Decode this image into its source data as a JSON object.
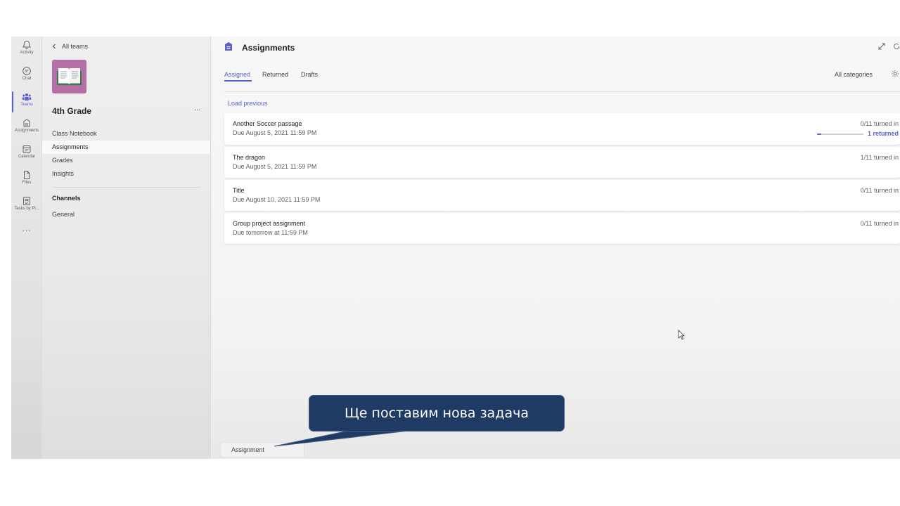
{
  "rail": {
    "items": [
      {
        "label": "Activity",
        "icon": "bell-icon"
      },
      {
        "label": "Chat",
        "icon": "chat-icon"
      },
      {
        "label": "Teams",
        "icon": "teams-icon",
        "active": true
      },
      {
        "label": "Assignments",
        "icon": "assignments-icon"
      },
      {
        "label": "Calendar",
        "icon": "calendar-icon"
      },
      {
        "label": "Files",
        "icon": "file-icon"
      },
      {
        "label": "Tasks by Pl...",
        "icon": "tasks-icon"
      }
    ],
    "more_label": "..."
  },
  "sidebar": {
    "back_label": "All teams",
    "team_name": "4th Grade",
    "more_label": "...",
    "nav": [
      {
        "label": "Class Notebook"
      },
      {
        "label": "Assignments",
        "active": true
      },
      {
        "label": "Grades"
      },
      {
        "label": "Insights"
      }
    ],
    "channels_heading": "Channels",
    "channels": [
      {
        "label": "General"
      }
    ]
  },
  "main": {
    "title": "Assignments",
    "tabs": [
      {
        "label": "Assigned",
        "active": true
      },
      {
        "label": "Returned"
      },
      {
        "label": "Drafts"
      }
    ],
    "filter_label": "All categories",
    "load_previous": "Load previous",
    "assignments": [
      {
        "title": "Another Soccer passage",
        "due": "Due August 5, 2021 11:59 PM",
        "turned_in": "0/11 turned in",
        "returned": "1 returned",
        "returned_fraction": 0.09
      },
      {
        "title": "The dragon",
        "due": "Due August 5, 2021 11:59 PM",
        "turned_in": "1/11 turned in"
      },
      {
        "title": "Title",
        "due": "Due August 10, 2021 11:59 PM",
        "turned_in": "0/11 turned in"
      },
      {
        "title": "Group project assignment",
        "due": "Due tomorrow at 11:59 PM",
        "turned_in": "0/11 turned in"
      }
    ],
    "tooltip": "Assignment"
  },
  "callout": {
    "text": "Ще поставим нова задача"
  },
  "colors": {
    "accent": "#5b5fc7",
    "team_avatar": "#b56fa4",
    "callout_bg": "#1f3a63"
  }
}
